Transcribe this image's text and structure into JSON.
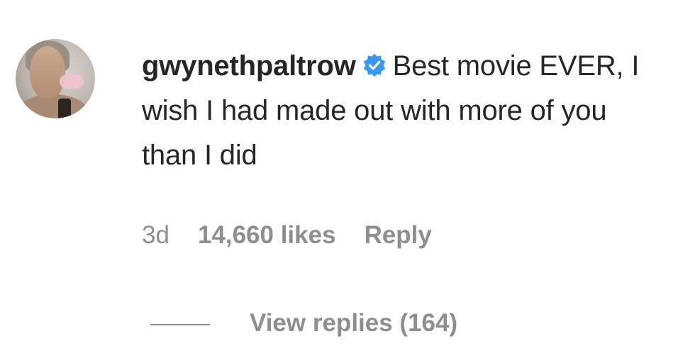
{
  "comment": {
    "username": "gwynethpaltrow",
    "verified_icon": "verified-badge-icon",
    "text": "Best movie EVER, I wish I had made out with more of you than I did",
    "age": "3d",
    "likes": "14,660 likes",
    "reply_label": "Reply",
    "view_replies_label": "View replies (164)",
    "accent_color": "#3897f0"
  }
}
